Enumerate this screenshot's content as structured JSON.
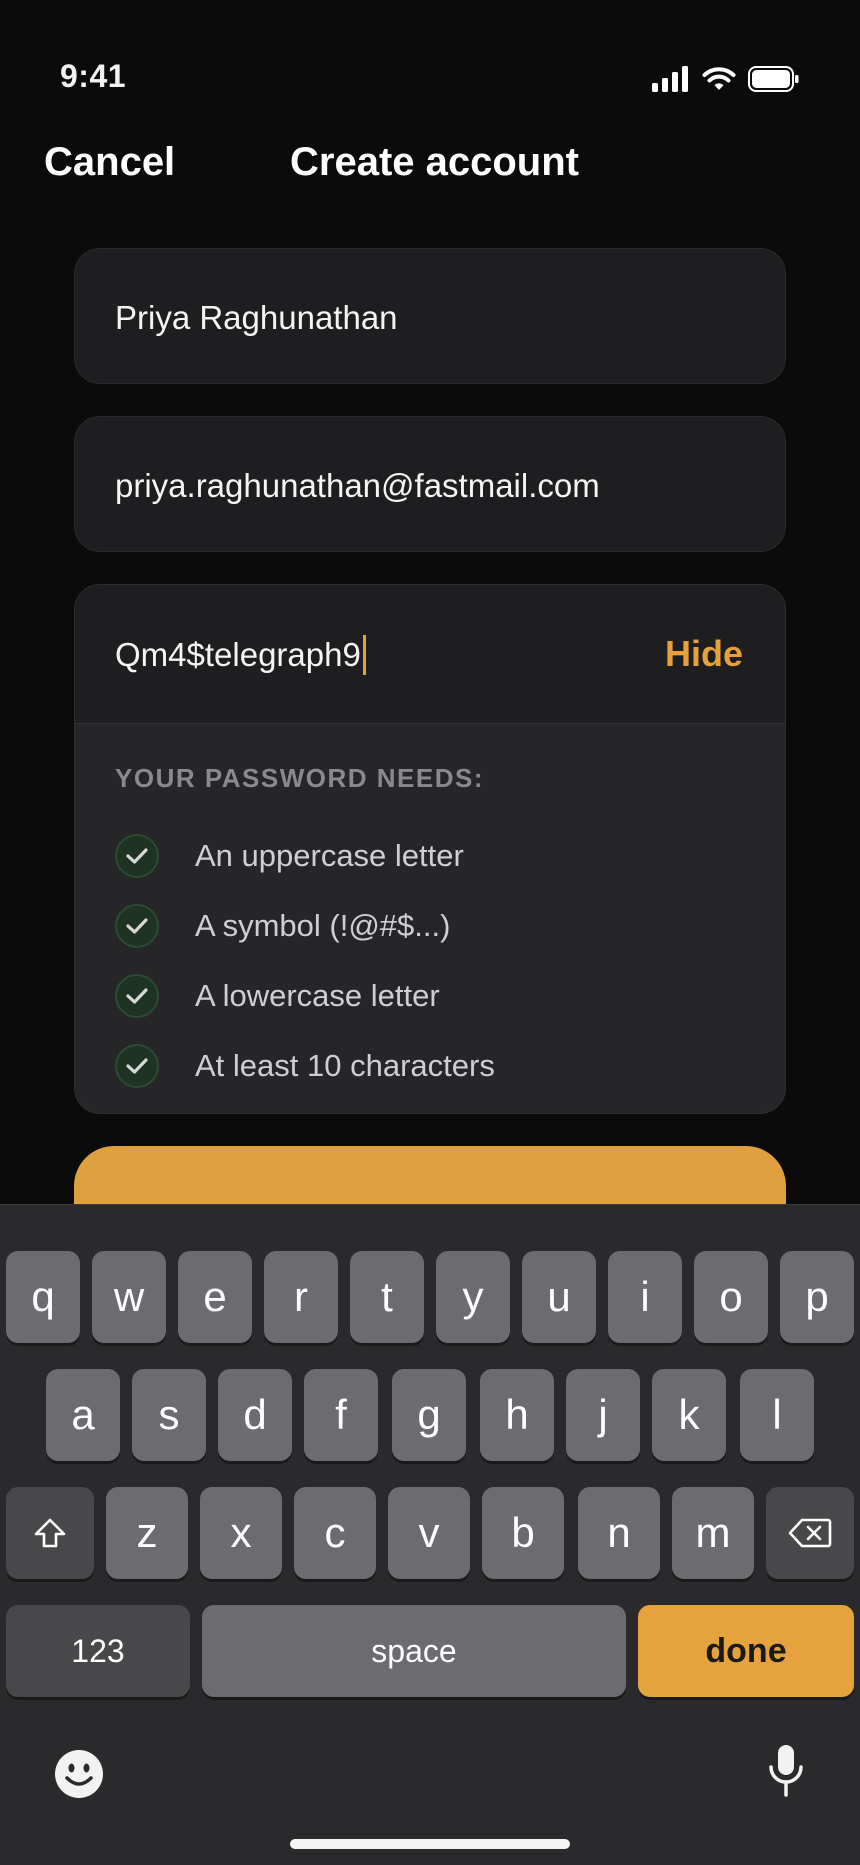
{
  "status_bar": {
    "time": "9:41"
  },
  "nav": {
    "cancel_label": "Cancel",
    "title": "Create account"
  },
  "form": {
    "name_value": "Priya Raghunathan",
    "email_value": "priya.raghunathan@fastmail.com",
    "password_value": "Qm4$telegraph9",
    "hide_label": "Hide"
  },
  "requirements": {
    "title": "YOUR PASSWORD NEEDS:",
    "items": [
      {
        "label": "An uppercase letter",
        "met": true
      },
      {
        "label": "A symbol (!@#$...)",
        "met": true
      },
      {
        "label": "A lowercase letter",
        "met": true
      },
      {
        "label": "At least 10 characters",
        "met": true
      }
    ]
  },
  "keyboard": {
    "row1": [
      "q",
      "w",
      "e",
      "r",
      "t",
      "y",
      "u",
      "i",
      "o",
      "p"
    ],
    "row2": [
      "a",
      "s",
      "d",
      "f",
      "g",
      "h",
      "j",
      "k",
      "l"
    ],
    "row3": [
      "z",
      "x",
      "c",
      "v",
      "b",
      "n",
      "m"
    ],
    "numbers_label": "123",
    "space_label": "space",
    "done_label": "done",
    "icons": {
      "shift": "shift-icon",
      "delete": "delete-icon",
      "emoji": "emoji-icon",
      "mic": "microphone-icon"
    }
  },
  "colors": {
    "accent": "#e6a23c",
    "background": "#0b0b0c",
    "field": "#1e1e20",
    "check": "#2d4a33"
  }
}
